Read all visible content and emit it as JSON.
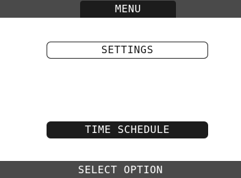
{
  "header": {
    "title": "MENU"
  },
  "menu": {
    "items": [
      {
        "label": "SETTINGS",
        "selected": false
      },
      {
        "label": "TIME SCHEDULE",
        "selected": true
      }
    ]
  },
  "footer": {
    "status": "SELECT OPTION"
  },
  "colors": {
    "bar": "#4a4a4a",
    "highlight": "#1c1c1c",
    "background": "#ffffff"
  }
}
